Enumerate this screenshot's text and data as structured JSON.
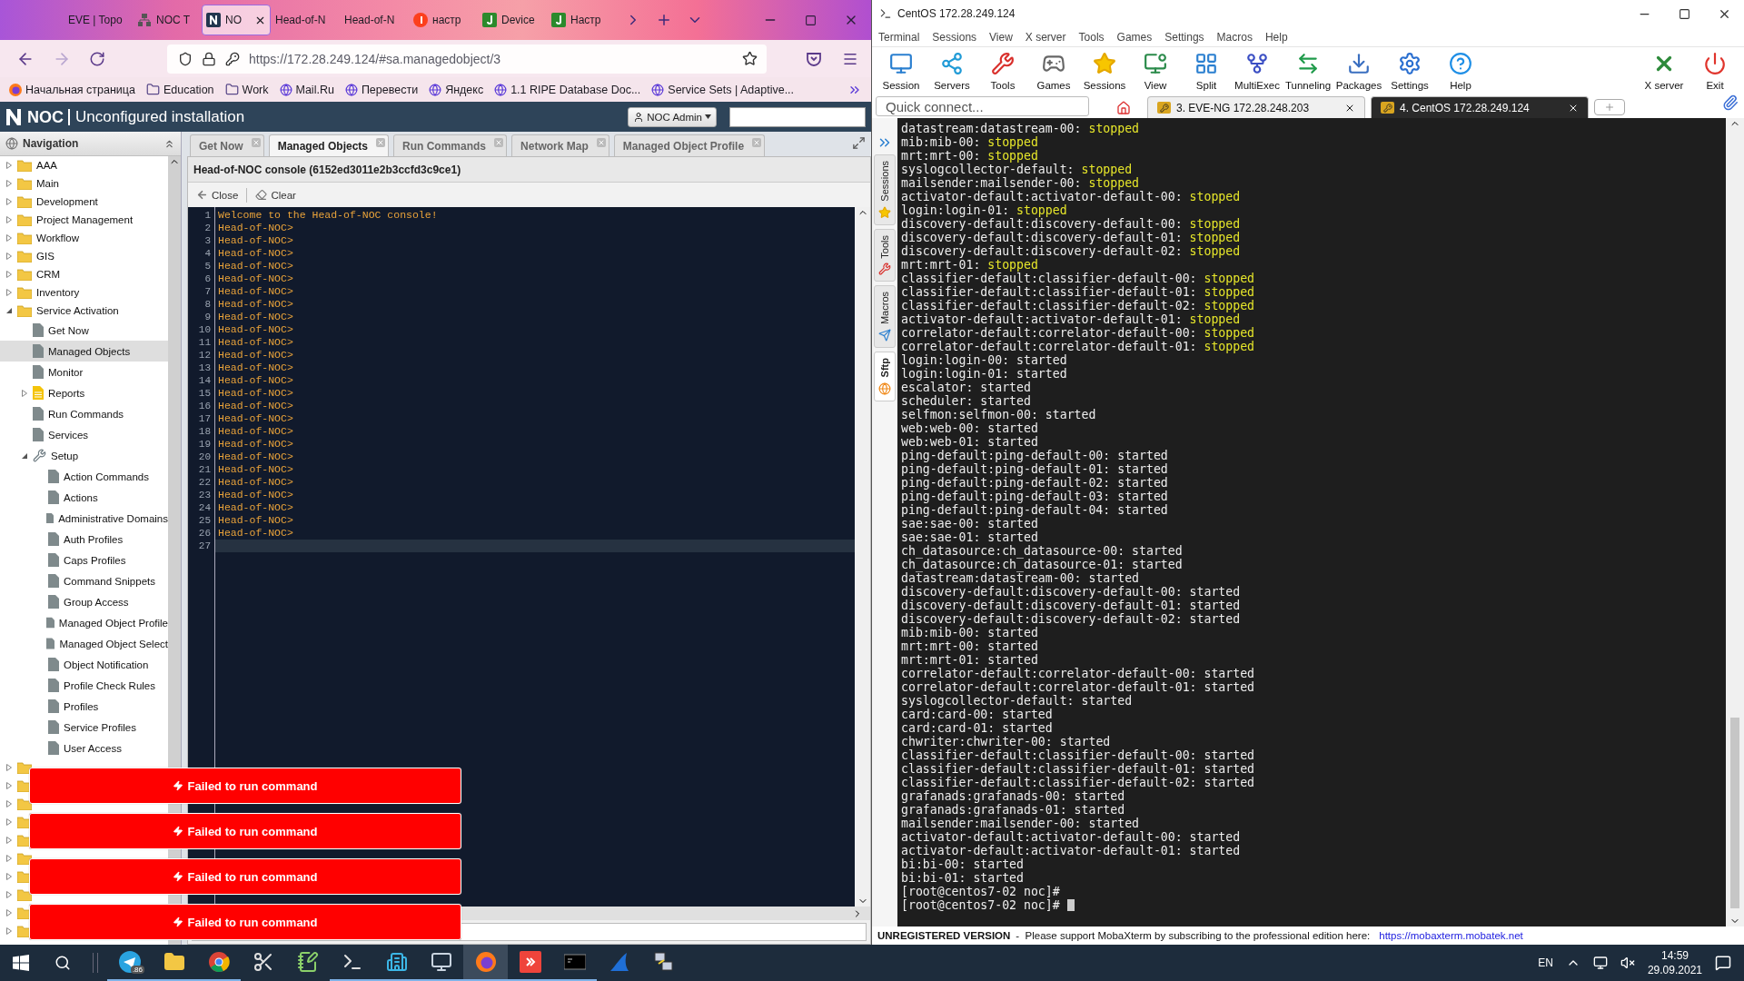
{
  "browser": {
    "tabs": [
      {
        "label": "EVE | Topo",
        "kind": "plain",
        "selected": false
      },
      {
        "label": "NOC T",
        "kind": "network",
        "selected": false
      },
      {
        "label": "NO",
        "kind": "noc",
        "selected": true
      },
      {
        "label": "Head-of-N",
        "kind": "plain",
        "selected": false
      },
      {
        "label": "Head-of-N",
        "kind": "plain",
        "selected": false
      },
      {
        "label": "настр",
        "kind": "yandex",
        "selected": false
      },
      {
        "label": "Device",
        "kind": "jira",
        "selected": false
      },
      {
        "label": "Настр",
        "kind": "jira",
        "selected": false
      }
    ],
    "url": "https://172.28.249.124/#sa.managedobject/3",
    "bookmarks": [
      {
        "label": "Начальная страница",
        "kind": "firefox"
      },
      {
        "label": "Education",
        "kind": "folder"
      },
      {
        "label": "Work",
        "kind": "folder"
      },
      {
        "label": "Mail.Ru",
        "kind": "globe"
      },
      {
        "label": "Перевести",
        "kind": "globe"
      },
      {
        "label": "Яндекс",
        "kind": "globe"
      },
      {
        "label": "1.1 RIPE Database Doc...",
        "kind": "globe"
      },
      {
        "label": "Service Sets | Adaptive...",
        "kind": "globe"
      }
    ]
  },
  "noc": {
    "brand": "NOC",
    "title": "Unconfigured installation",
    "user": "NOC Admin",
    "navigation_title": "Navigation",
    "nav_tree": [
      {
        "label": "AAA",
        "kind": "folder",
        "expanded": false,
        "selected": false
      },
      {
        "label": "Main",
        "kind": "folder",
        "expanded": false,
        "selected": false
      },
      {
        "label": "Development",
        "kind": "folder",
        "expanded": false,
        "selected": false
      },
      {
        "label": "Project Management",
        "kind": "folder",
        "expanded": false,
        "selected": false
      },
      {
        "label": "Workflow",
        "kind": "folder",
        "expanded": false,
        "selected": false
      },
      {
        "label": "GIS",
        "kind": "folder",
        "expanded": false,
        "selected": false
      },
      {
        "label": "CRM",
        "kind": "folder",
        "expanded": false,
        "selected": false
      },
      {
        "label": "Inventory",
        "kind": "folder",
        "expanded": false,
        "selected": false
      },
      {
        "label": "Service Activation",
        "kind": "folder",
        "expanded": true,
        "selected": false,
        "children": [
          {
            "label": "Get Now",
            "kind": "page",
            "selected": false
          },
          {
            "label": "Managed Objects",
            "kind": "page",
            "selected": true
          },
          {
            "label": "Monitor",
            "kind": "page",
            "selected": false
          },
          {
            "label": "Reports",
            "kind": "report",
            "expanded": false,
            "selected": false
          },
          {
            "label": "Run Commands",
            "kind": "page",
            "selected": false
          },
          {
            "label": "Services",
            "kind": "page",
            "selected": false
          },
          {
            "label": "Setup",
            "kind": "tool",
            "expanded": true,
            "selected": false,
            "children": [
              {
                "label": "Action Commands",
                "kind": "page",
                "selected": false
              },
              {
                "label": "Actions",
                "kind": "page",
                "selected": false
              },
              {
                "label": "Administrative Domains",
                "kind": "page",
                "selected": false
              },
              {
                "label": "Auth Profiles",
                "kind": "page",
                "selected": false
              },
              {
                "label": "Caps Profiles",
                "kind": "page",
                "selected": false
              },
              {
                "label": "Command Snippets",
                "kind": "page",
                "selected": false
              },
              {
                "label": "Group Access",
                "kind": "page",
                "selected": false
              },
              {
                "label": "Managed Object Profile",
                "kind": "page",
                "selected": false
              },
              {
                "label": "Managed Object Select",
                "kind": "page",
                "selected": false
              },
              {
                "label": "Object Notification",
                "kind": "page",
                "selected": false
              },
              {
                "label": "Profile Check Rules",
                "kind": "page",
                "selected": false
              },
              {
                "label": "Profiles",
                "kind": "page",
                "selected": false
              },
              {
                "label": "Service Profiles",
                "kind": "page",
                "selected": false
              },
              {
                "label": "User Access",
                "kind": "page",
                "selected": false
              }
            ]
          }
        ]
      },
      {
        "kind": "folder",
        "expanded": false,
        "selected": false
      },
      {
        "kind": "folder",
        "expanded": false,
        "selected": false
      },
      {
        "kind": "folder",
        "expanded": false,
        "selected": false
      },
      {
        "kind": "folder",
        "expanded": false,
        "selected": false
      },
      {
        "kind": "folder",
        "expanded": false,
        "selected": false
      },
      {
        "kind": "folder",
        "expanded": false,
        "selected": false
      },
      {
        "kind": "folder",
        "expanded": false,
        "selected": false
      },
      {
        "kind": "folder",
        "expanded": false,
        "selected": false
      },
      {
        "kind": "folder",
        "expanded": false,
        "selected": false
      },
      {
        "kind": "folder",
        "expanded": false,
        "selected": false
      }
    ],
    "tabs": [
      {
        "label": "Get Now",
        "selected": false
      },
      {
        "label": "Managed Objects",
        "selected": true
      },
      {
        "label": "Run Commands",
        "selected": false
      },
      {
        "label": "Network Map",
        "selected": false
      },
      {
        "label": "Managed Object Profile",
        "selected": false
      }
    ],
    "console": {
      "title": "Head-of-NOC console (6152ed3011e2b3ccfd3c9ce1)",
      "actions": [
        "Close",
        "Clear"
      ],
      "lines": [
        {
          "number": "1",
          "text": "Welcome to the Head-of-NOC console!",
          "current": false
        },
        {
          "number": "2",
          "text": "Head-of-NOC>",
          "current": false
        },
        {
          "number": "3",
          "text": "Head-of-NOC>",
          "current": false
        },
        {
          "number": "4",
          "text": "Head-of-NOC>",
          "current": false
        },
        {
          "number": "5",
          "text": "Head-of-NOC>",
          "current": false
        },
        {
          "number": "6",
          "text": "Head-of-NOC>",
          "current": false
        },
        {
          "number": "7",
          "text": "Head-of-NOC>",
          "current": false
        },
        {
          "number": "8",
          "text": "Head-of-NOC>",
          "current": false
        },
        {
          "number": "9",
          "text": "Head-of-NOC>",
          "current": false
        },
        {
          "number": "10",
          "text": "Head-of-NOC>",
          "current": false
        },
        {
          "number": "11",
          "text": "Head-of-NOC>",
          "current": false
        },
        {
          "number": "12",
          "text": "Head-of-NOC>",
          "current": false
        },
        {
          "number": "13",
          "text": "Head-of-NOC>",
          "current": false
        },
        {
          "number": "14",
          "text": "Head-of-NOC>",
          "current": false
        },
        {
          "number": "15",
          "text": "Head-of-NOC>",
          "current": false
        },
        {
          "number": "16",
          "text": "Head-of-NOC>",
          "current": false
        },
        {
          "number": "17",
          "text": "Head-of-NOC>",
          "current": false
        },
        {
          "number": "18",
          "text": "Head-of-NOC>",
          "current": false
        },
        {
          "number": "19",
          "text": "Head-of-NOC>",
          "current": false
        },
        {
          "number": "20",
          "text": "Head-of-NOC>",
          "current": false
        },
        {
          "number": "21",
          "text": "Head-of-NOC>",
          "current": false
        },
        {
          "number": "22",
          "text": "Head-of-NOC>",
          "current": false
        },
        {
          "number": "23",
          "text": "Head-of-NOC>",
          "current": false
        },
        {
          "number": "24",
          "text": "Head-of-NOC>",
          "current": false
        },
        {
          "number": "25",
          "text": "Head-of-NOC>",
          "current": false
        },
        {
          "number": "26",
          "text": "Head-of-NOC>",
          "current": false
        },
        {
          "number": "27",
          "current": true
        }
      ]
    },
    "notifications": [
      "Failed to run command",
      "Failed to run command",
      "Failed to run command",
      "Failed to run command"
    ]
  },
  "mobaxterm": {
    "title": "CentOS 172.28.249.124",
    "menu": [
      "Terminal",
      "Sessions",
      "View",
      "X server",
      "Tools",
      "Games",
      "Settings",
      "Macros",
      "Help"
    ],
    "toolbar": [
      {
        "label": "Session",
        "kind": "session"
      },
      {
        "label": "Servers",
        "kind": "servers"
      },
      {
        "label": "Tools",
        "kind": "tools"
      },
      {
        "label": "Games",
        "kind": "games"
      },
      {
        "label": "Sessions",
        "kind": "sessions"
      },
      {
        "label": "View",
        "kind": "view"
      },
      {
        "label": "Split",
        "kind": "split"
      },
      {
        "label": "MultiExec",
        "kind": "multiexec"
      },
      {
        "label": "Tunneling",
        "kind": "tunneling"
      },
      {
        "label": "Packages",
        "kind": "packages"
      },
      {
        "label": "Settings",
        "kind": "settings"
      },
      {
        "label": "Help",
        "kind": "help"
      }
    ],
    "toolbar_right": [
      {
        "label": "X server",
        "kind": "xserver"
      },
      {
        "label": "Exit",
        "kind": "exit"
      }
    ],
    "quick_connect": {
      "placeholder": "Quick connect..."
    },
    "sessions": [
      {
        "label": "3. EVE-NG 172.28.248.203",
        "selected": false
      },
      {
        "label": "4. CentOS 172.28.249.124",
        "selected": true
      }
    ],
    "side_tabs": [
      {
        "label": "Sessions",
        "kind": "star",
        "selected": false
      },
      {
        "label": "Tools",
        "kind": "tools",
        "selected": false
      },
      {
        "label": "Macros",
        "kind": "plane",
        "selected": false
      },
      {
        "label": "Sftp",
        "kind": "globe",
        "selected": true
      }
    ],
    "terminal": [
      {
        "text": "datastream:datastream-00:",
        "status": "stopped",
        "highlight": true
      },
      {
        "text": "mib:mib-00:",
        "status": "stopped",
        "highlight": true
      },
      {
        "text": "mrt:mrt-00:",
        "status": "stopped",
        "highlight": true
      },
      {
        "text": "syslogcollector-default:",
        "status": "stopped",
        "highlight": true
      },
      {
        "text": "mailsender:mailsender-00:",
        "status": "stopped",
        "highlight": true
      },
      {
        "text": "activator-default:activator-default-00:",
        "status": "stopped",
        "highlight": true
      },
      {
        "text": "login:login-01:",
        "status": "stopped",
        "highlight": true
      },
      {
        "text": "discovery-default:discovery-default-00:",
        "status": "stopped",
        "highlight": true
      },
      {
        "text": "discovery-default:discovery-default-01:",
        "status": "stopped",
        "highlight": true
      },
      {
        "text": "discovery-default:discovery-default-02:",
        "status": "stopped",
        "highlight": true
      },
      {
        "text": "mrt:mrt-01:",
        "status": "stopped",
        "highlight": true
      },
      {
        "text": "classifier-default:classifier-default-00:",
        "status": "stopped",
        "highlight": true
      },
      {
        "text": "classifier-default:classifier-default-01:",
        "status": "stopped",
        "highlight": true
      },
      {
        "text": "classifier-default:classifier-default-02:",
        "status": "stopped",
        "highlight": true
      },
      {
        "text": "activator-default:activator-default-01:",
        "status": "stopped",
        "highlight": true
      },
      {
        "text": "correlator-default:correlator-default-00:",
        "status": "stopped",
        "highlight": true
      },
      {
        "text": "correlator-default:correlator-default-01:",
        "status": "stopped",
        "highlight": true
      },
      {
        "text": "login:login-00:",
        "status": "started",
        "highlight": false
      },
      {
        "text": "login:login-01:",
        "status": "started",
        "highlight": false
      },
      {
        "text": "escalator:",
        "status": "started",
        "highlight": false
      },
      {
        "text": "scheduler:",
        "status": "started",
        "highlight": false
      },
      {
        "text": "selfmon:selfmon-00:",
        "status": "started",
        "highlight": false
      },
      {
        "text": "web:web-00:",
        "status": "started",
        "highlight": false
      },
      {
        "text": "web:web-01:",
        "status": "started",
        "highlight": false
      },
      {
        "text": "ping-default:ping-default-00:",
        "status": "started",
        "highlight": false
      },
      {
        "text": "ping-default:ping-default-01:",
        "status": "started",
        "highlight": false
      },
      {
        "text": "ping-default:ping-default-02:",
        "status": "started",
        "highlight": false
      },
      {
        "text": "ping-default:ping-default-03:",
        "status": "started",
        "highlight": false
      },
      {
        "text": "ping-default:ping-default-04:",
        "status": "started",
        "highlight": false
      },
      {
        "text": "sae:sae-00:",
        "status": "started",
        "highlight": false
      },
      {
        "text": "sae:sae-01:",
        "status": "started",
        "highlight": false
      },
      {
        "text": "ch_datasource:ch_datasource-00:",
        "status": "started",
        "highlight": false
      },
      {
        "text": "ch_datasource:ch_datasource-01:",
        "status": "started",
        "highlight": false
      },
      {
        "text": "datastream:datastream-00:",
        "status": "started",
        "highlight": false
      },
      {
        "text": "discovery-default:discovery-default-00:",
        "status": "started",
        "highlight": false
      },
      {
        "text": "discovery-default:discovery-default-01:",
        "status": "started",
        "highlight": false
      },
      {
        "text": "discovery-default:discovery-default-02:",
        "status": "started",
        "highlight": false
      },
      {
        "text": "mib:mib-00:",
        "status": "started",
        "highlight": false
      },
      {
        "text": "mrt:mrt-00:",
        "status": "started",
        "highlight": false
      },
      {
        "text": "mrt:mrt-01:",
        "status": "started",
        "highlight": false
      },
      {
        "text": "correlator-default:correlator-default-00:",
        "status": "started",
        "highlight": false
      },
      {
        "text": "correlator-default:correlator-default-01:",
        "status": "started",
        "highlight": false
      },
      {
        "text": "syslogcollector-default:",
        "status": "started",
        "highlight": false
      },
      {
        "text": "card:card-00:",
        "status": "started",
        "highlight": false
      },
      {
        "text": "card:card-01:",
        "status": "started",
        "highlight": false
      },
      {
        "text": "chwriter:chwriter-00:",
        "status": "started",
        "highlight": false
      },
      {
        "text": "classifier-default:classifier-default-00:",
        "status": "started",
        "highlight": false
      },
      {
        "text": "classifier-default:classifier-default-01:",
        "status": "started",
        "highlight": false
      },
      {
        "text": "classifier-default:classifier-default-02:",
        "status": "started",
        "highlight": false
      },
      {
        "text": "grafanads:grafanads-00:",
        "status": "started",
        "highlight": false
      },
      {
        "text": "grafanads:grafanads-01:",
        "status": "started",
        "highlight": false
      },
      {
        "text": "mailsender:mailsender-00:",
        "status": "started",
        "highlight": false
      },
      {
        "text": "activator-default:activator-default-00:",
        "status": "started",
        "highlight": false
      },
      {
        "text": "activator-default:activator-default-01:",
        "status": "started",
        "highlight": false
      },
      {
        "text": "bi:bi-00:",
        "status": "started",
        "highlight": false
      },
      {
        "text": "bi:bi-01:",
        "status": "started",
        "highlight": false
      },
      {
        "text": "[root@centos7-02 noc]#",
        "cursor": false
      },
      {
        "text": "[root@centos7-02 noc]#",
        "cursor": true
      }
    ],
    "status": {
      "label": "UNREGISTERED VERSION",
      "message": "-  Please support MobaXterm by subscribing to the professional edition here:",
      "link": "https://mobaxterm.mobatek.net"
    }
  },
  "taskbar": {
    "apps": [
      {
        "kind": "telegram",
        "badge": ".86",
        "active": false,
        "running": true
      },
      {
        "kind": "explorer",
        "active": false,
        "running": true
      },
      {
        "kind": "chrome",
        "active": false,
        "running": true
      },
      {
        "kind": "snip",
        "active": false,
        "running": false
      },
      {
        "kind": "notepad",
        "active": false,
        "running": false
      },
      {
        "kind": "termapp",
        "active": false,
        "running": true
      },
      {
        "kind": "buildings",
        "active": false,
        "running": true
      },
      {
        "kind": "network",
        "active": false,
        "running": true
      },
      {
        "kind": "firefox",
        "active": true,
        "running": true
      },
      {
        "kind": "anydesk",
        "active": false,
        "running": true
      },
      {
        "kind": "cmd",
        "active": false,
        "running": true
      },
      {
        "kind": "wireshark",
        "active": false,
        "running": false
      },
      {
        "kind": "putty",
        "active": false,
        "running": false
      }
    ],
    "language": "EN",
    "time": "14:59",
    "date": "29.09.2021"
  }
}
